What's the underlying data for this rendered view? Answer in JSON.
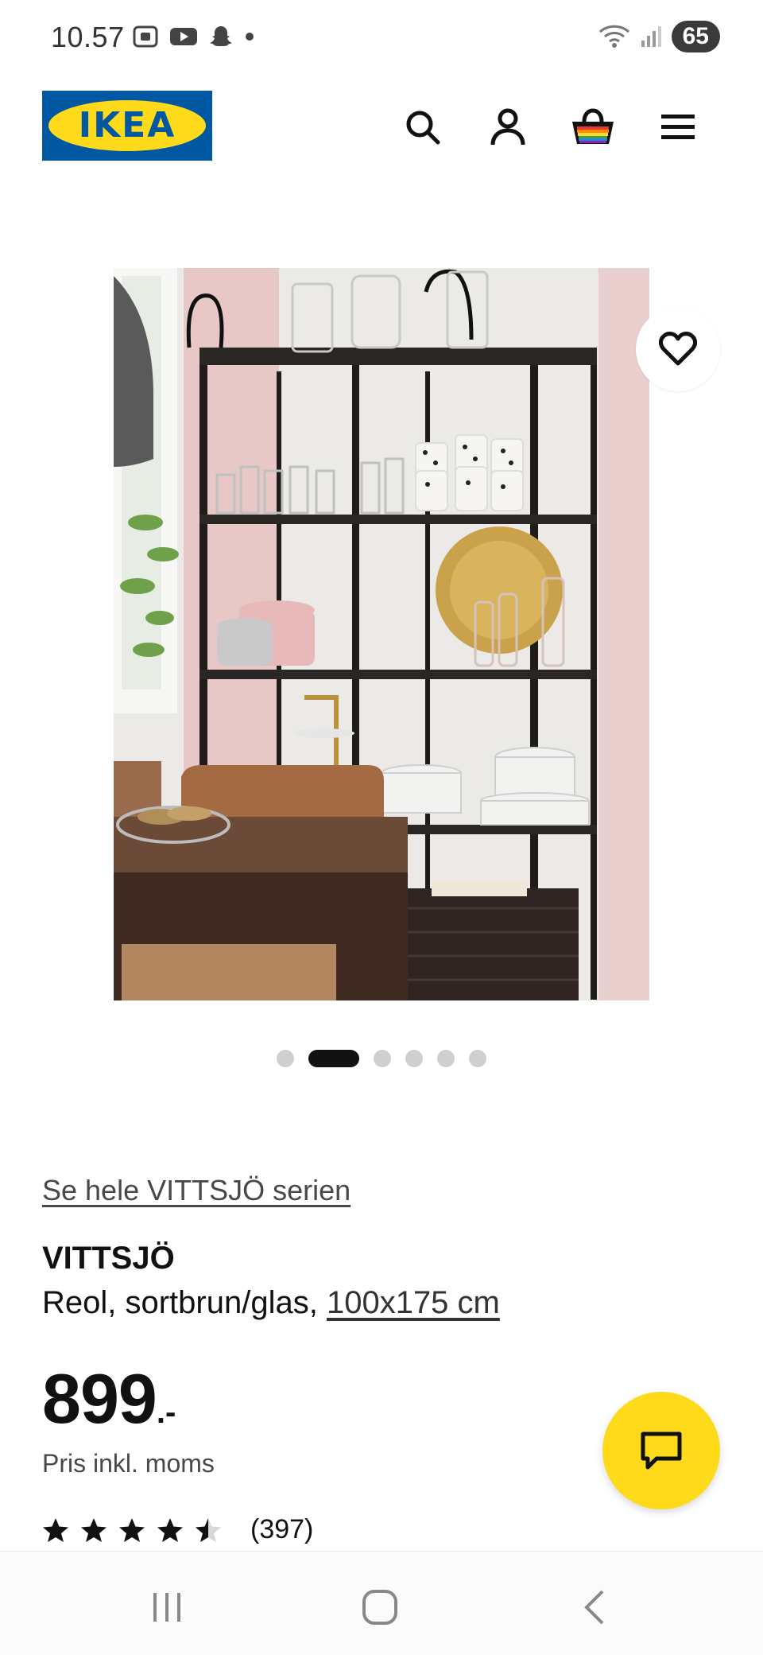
{
  "status_bar": {
    "time": "10.57",
    "battery": "65",
    "left_icons": [
      "screenshot-icon",
      "youtube-icon",
      "snapchat-icon",
      "dot-icon"
    ],
    "right_icons": [
      "wifi-icon",
      "signal-icon"
    ]
  },
  "header": {
    "logo_text": "IKEA",
    "icons": [
      "search-icon",
      "account-icon",
      "basket-icon",
      "menu-icon"
    ]
  },
  "gallery": {
    "dot_count": 6,
    "active_index": 1
  },
  "product": {
    "series_link": "Se hele VITTSJÖ serien",
    "name": "VITTSJÖ",
    "description_prefix": "Reol, sortbrun/glas, ",
    "size_link": "100x175 cm",
    "price_integer": "899",
    "price_suffix": ".-",
    "price_note": "Pris inkl. moms",
    "rating_value": 4.5,
    "rating_max": 5,
    "review_count": "(397)"
  },
  "colors": {
    "ikea_blue": "#0058A3",
    "ikea_yellow": "#FFDA1A",
    "text": "#111111"
  }
}
